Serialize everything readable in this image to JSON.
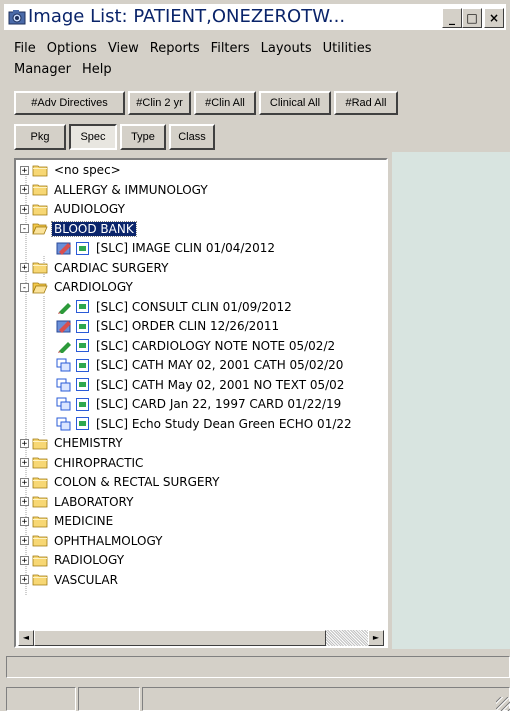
{
  "window": {
    "title": "Image List: PATIENT,ONEZEROTW..."
  },
  "titlebar_buttons": {
    "minimize": "_",
    "maximize": "□",
    "close": "×"
  },
  "menu": [
    "File",
    "Options",
    "View",
    "Reports",
    "Filters",
    "Layouts",
    "Utilities",
    "Manager",
    "Help"
  ],
  "filter_buttons": [
    "#Adv Directives",
    "#Clin 2 yr",
    "#Clin All",
    "Clinical All",
    "#Rad All"
  ],
  "group_buttons": [
    {
      "label": "Pkg",
      "pressed": false
    },
    {
      "label": "Spec",
      "pressed": true
    },
    {
      "label": "Type",
      "pressed": false
    },
    {
      "label": "Class",
      "pressed": false
    }
  ],
  "tree": [
    {
      "label": "<no spec>",
      "kind": "folder",
      "expander": "+"
    },
    {
      "label": "ALLERGY & IMMUNOLOGY",
      "kind": "folder",
      "expander": "+"
    },
    {
      "label": "AUDIOLOGY",
      "kind": "folder",
      "expander": "+"
    },
    {
      "label": "BLOOD BANK",
      "kind": "folder-open",
      "expander": "-",
      "selected": true
    },
    {
      "label": "[SLC] IMAGE CLIN 01/04/2012",
      "kind": "doc",
      "lead": "edit-check-icon"
    },
    {
      "label": "CARDIAC SURGERY",
      "kind": "folder",
      "expander": "+"
    },
    {
      "label": "CARDIOLOGY",
      "kind": "folder-open",
      "expander": "-"
    },
    {
      "label": "[SLC] CONSULT CLIN 01/09/2012",
      "kind": "doc",
      "lead": "pencil-icon"
    },
    {
      "label": "[SLC] ORDER CLIN 12/26/2011",
      "kind": "doc",
      "lead": "edit-check-icon"
    },
    {
      "label": "[SLC] CARDIOLOGY NOTE NOTE 05/02/2",
      "kind": "doc",
      "lead": "pencil-icon"
    },
    {
      "label": "[SLC] CATH MAY 02, 2001 CATH 05/02/20",
      "kind": "doc",
      "lead": "copy-icon"
    },
    {
      "label": "[SLC] CATH  May 02, 2001 NO TEXT 05/02",
      "kind": "doc",
      "lead": "copy-icon"
    },
    {
      "label": "[SLC] CARD  Jan 22, 1997 CARD 01/22/19",
      "kind": "doc",
      "lead": "copy-icon"
    },
    {
      "label": "[SLC] Echo Study Dean Green ECHO 01/22",
      "kind": "doc",
      "lead": "copy-icon"
    },
    {
      "label": "CHEMISTRY",
      "kind": "folder",
      "expander": "+"
    },
    {
      "label": "CHIROPRACTIC",
      "kind": "folder",
      "expander": "+"
    },
    {
      "label": "COLON & RECTAL SURGERY",
      "kind": "folder",
      "expander": "+"
    },
    {
      "label": "LABORATORY",
      "kind": "folder",
      "expander": "+"
    },
    {
      "label": "MEDICINE",
      "kind": "folder",
      "expander": "+"
    },
    {
      "label": "OPHTHALMOLOGY",
      "kind": "folder",
      "expander": "+"
    },
    {
      "label": "RADIOLOGY",
      "kind": "folder",
      "expander": "+"
    },
    {
      "label": "VASCULAR",
      "kind": "folder",
      "expander": "+"
    }
  ],
  "scroll": {
    "left": "◄",
    "right": "►"
  },
  "colors": {
    "title_text": "#0a246a",
    "selection": "#0a246a",
    "folder": "#f7d774",
    "right_pane": "#d8e4e0"
  }
}
